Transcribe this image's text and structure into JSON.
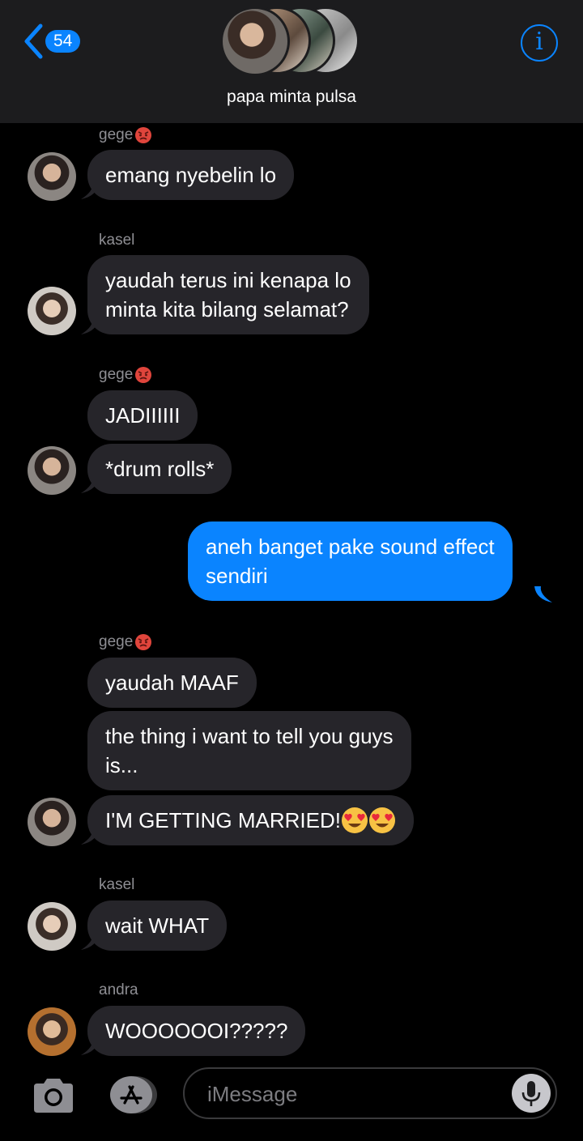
{
  "header": {
    "unread_count": "54",
    "group_name": "papa minta pulsa",
    "info_glyph": "i"
  },
  "messages": [
    {
      "sender": "gege",
      "text": "emang nyebelin lo"
    },
    {
      "sender": "kasel",
      "line1": "yaudah terus ini kenapa lo",
      "line2": "minta kita bilang selamat?"
    },
    {
      "sender": "gege",
      "text1": "JADIIIIII",
      "text2": "*drum rolls*"
    },
    {
      "sender": "me",
      "line1": "aneh banget pake sound effect",
      "line2": "sendiri"
    },
    {
      "sender": "gege",
      "text1": "yaudah MAAF",
      "line1": "the thing i want to tell you guys",
      "line2": "is...",
      "text3": "I'M GETTING MARRIED!"
    },
    {
      "sender": "kasel",
      "text": "wait WHAT"
    },
    {
      "sender": "andra",
      "text": "WOOOOOOI?????"
    }
  ],
  "input": {
    "placeholder": "iMessage"
  },
  "colors": {
    "accent": "#0a84ff",
    "incoming_bubble": "#26252a",
    "header_bg": "#1c1c1e"
  }
}
